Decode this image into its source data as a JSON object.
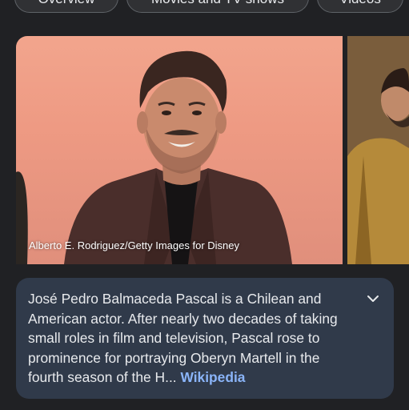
{
  "tabs": [
    {
      "label": "Overview"
    },
    {
      "label": "Movies and TV shows"
    },
    {
      "label": "Videos"
    }
  ],
  "image": {
    "credit": "Alberto E. Rodriguez/Getty Images for Disney"
  },
  "description": {
    "text": "José Pedro Balmaceda Pascal is a Chilean and American actor. After nearly two decades of taking small roles in film and television, Pascal rose to prominence for portraying Oberyn Martell in the fourth season of the H... ",
    "source_link": "Wikipedia",
    "expand_icon": "chevron-down-icon"
  },
  "colors": {
    "background": "#202124",
    "card": "#303a4a",
    "link": "#8ab4f8"
  }
}
